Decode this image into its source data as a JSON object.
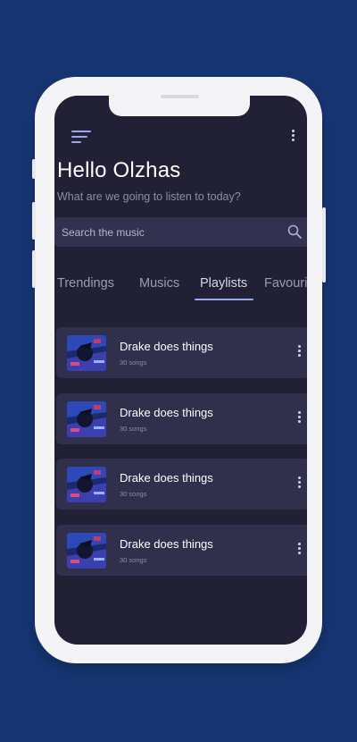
{
  "colors": {
    "background": "#173673",
    "screen": "#212035",
    "card": "#302f4c",
    "accent": "#9aa7e8"
  },
  "header": {
    "menu_icon": "hamburger-menu-icon",
    "more_icon": "vertical-dots-icon",
    "title": "Hello Olzhas",
    "subtitle": "What are we going to listen to today?"
  },
  "search": {
    "placeholder": "Search the music",
    "icon": "search-icon"
  },
  "tabs": [
    {
      "label": "Trendings",
      "active": false
    },
    {
      "label": "Musics",
      "active": false
    },
    {
      "label": "Playlists",
      "active": true
    },
    {
      "label": "Favourites",
      "active": false
    }
  ],
  "playlists": [
    {
      "title": "Drake does things",
      "subtitle": "30 songs"
    },
    {
      "title": "Drake does things",
      "subtitle": "30 songs"
    },
    {
      "title": "Drake does things",
      "subtitle": "30 songs"
    },
    {
      "title": "Drake does things",
      "subtitle": "30 songs"
    }
  ]
}
